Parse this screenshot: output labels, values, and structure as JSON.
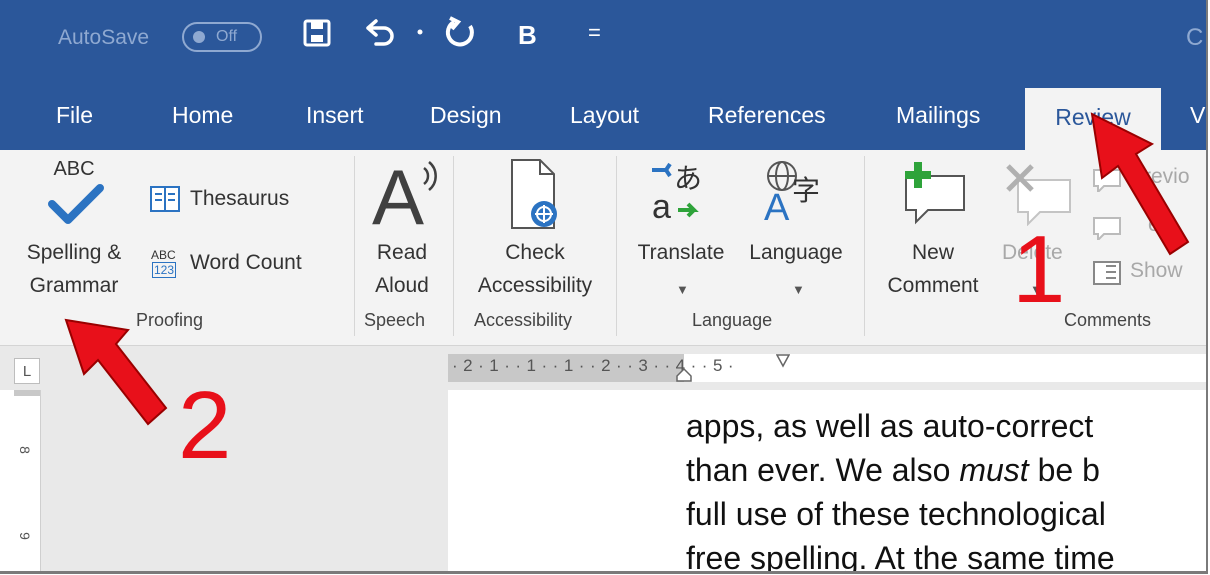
{
  "titlebar": {
    "autosave_label": "AutoSave",
    "autosave_state": "Off",
    "qat_bold": "B",
    "qat_more": "=",
    "title_partial": "C"
  },
  "tabs": [
    "File",
    "Home",
    "Insert",
    "Design",
    "Layout",
    "References",
    "Mailings",
    "Review",
    "V"
  ],
  "active_tab": "Review",
  "ribbon": {
    "proofing": {
      "abc": "ABC",
      "spelling_line1": "Spelling &",
      "spelling_line2": "Grammar",
      "thesaurus": "Thesaurus",
      "word_count": "Word Count",
      "abc_small": "ABC",
      "num_small": "123",
      "group": "Proofing"
    },
    "speech": {
      "read_line1": "Read",
      "read_line2": "Aloud",
      "group": "Speech"
    },
    "accessibility": {
      "check_line1": "Check",
      "check_line2": "Accessibility",
      "group": "Accessibility"
    },
    "language": {
      "translate": "Translate",
      "language": "Language",
      "group": "Language"
    },
    "comments": {
      "new_line1": "New",
      "new_line2": "Comment",
      "delete": "Delete",
      "previous": "Previo",
      "next": "ext",
      "show": "Show",
      "group": "Comments"
    }
  },
  "ruler": {
    "corner": "L",
    "marks": "·2·1··1··1··2··3··4··5·",
    "vmark_8": "8",
    "vmark_9": "9"
  },
  "document": {
    "lines": [
      "apps, as well as auto-correct",
      "than ever. We also ",
      "must",
      " be b",
      "full use of these technological",
      "free spelling. At the same time"
    ]
  },
  "annotations": {
    "num1": "1",
    "num2": "2"
  },
  "colors": {
    "accent": "#2b579a",
    "ribbon_bg": "#f3f3f3",
    "annotation": "#e8101a"
  }
}
